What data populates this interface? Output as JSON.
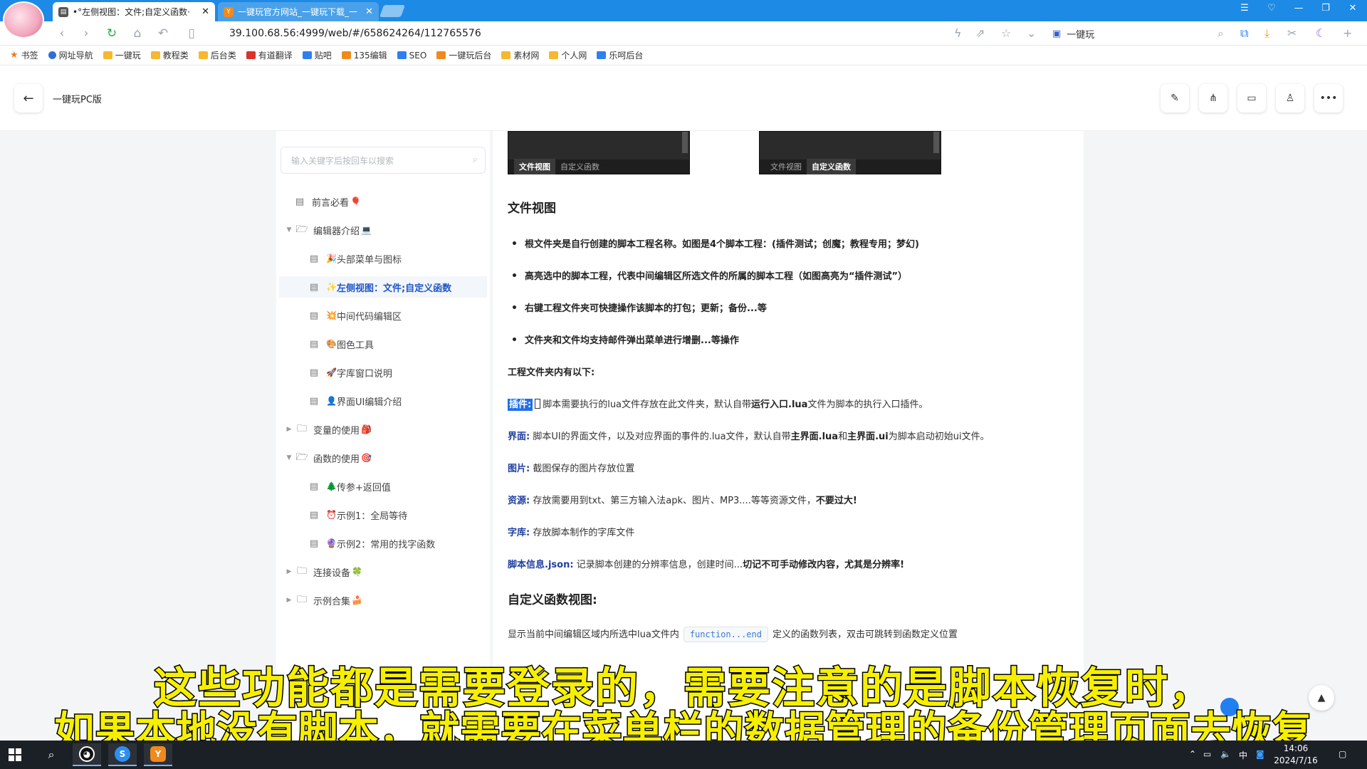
{
  "browser": {
    "tabs": [
      {
        "title": "•°左侧视图：文件;自定义函数·",
        "active": true
      },
      {
        "title": "一键玩官方网站_一键玩下载_一",
        "active": false
      }
    ],
    "url": "39.100.68.56:4999/web/#/658624264/112765576",
    "search_text": "一键玩",
    "bookmarks": [
      {
        "label": "书签",
        "icon": "star-icon"
      },
      {
        "label": "网址导航",
        "icon": "nav-icon"
      },
      {
        "label": "一键玩",
        "icon": "folder-icon"
      },
      {
        "label": "教程类",
        "icon": "folder-icon"
      },
      {
        "label": "后台类",
        "icon": "folder-icon"
      },
      {
        "label": "有道翻译",
        "icon": "youdao-icon"
      },
      {
        "label": "贴吧",
        "icon": "paw-icon"
      },
      {
        "label": "135编辑",
        "icon": "editor-icon"
      },
      {
        "label": "SEO",
        "icon": "paw-icon"
      },
      {
        "label": "一键玩后台",
        "icon": "app-icon"
      },
      {
        "label": "素材网",
        "icon": "folder-icon"
      },
      {
        "label": "个人网",
        "icon": "folder-icon"
      },
      {
        "label": "乐呵后台",
        "icon": "app-icon"
      }
    ]
  },
  "header": {
    "title": "一键玩PC版",
    "back_icon": "←"
  },
  "sidebar": {
    "search_placeholder": "输入关键字后按回车以搜索",
    "items": [
      {
        "label": "前言必看",
        "emoji": "🎈",
        "kind": "doc",
        "level": 0
      },
      {
        "label": "编辑器介绍",
        "emoji": "💻",
        "kind": "folder-open",
        "level": 0
      },
      {
        "label": "头部菜单与图标",
        "emoji": "🎉",
        "kind": "doc",
        "level": 1
      },
      {
        "label": "左侧视图：文件;自定义函数",
        "emoji": "✨",
        "kind": "doc",
        "level": 1,
        "active": true
      },
      {
        "label": "中间代码编辑区",
        "emoji": "💥",
        "kind": "doc",
        "level": 1
      },
      {
        "label": "图色工具",
        "emoji": "🎨",
        "kind": "doc",
        "level": 1
      },
      {
        "label": "字库窗口说明",
        "emoji": "🚀",
        "kind": "doc",
        "level": 1
      },
      {
        "label": "界面UI编辑介绍",
        "emoji": "👤",
        "kind": "doc",
        "level": 1
      },
      {
        "label": "变量的使用",
        "emoji": "🎒",
        "kind": "folder",
        "level": 0
      },
      {
        "label": "函数的使用",
        "emoji": "🎯",
        "kind": "folder-open",
        "level": 0
      },
      {
        "label": "传参+返回值",
        "emoji": "🌲",
        "kind": "doc",
        "level": 1
      },
      {
        "label": "示例1：全局等待",
        "emoji": "⏰",
        "kind": "doc",
        "level": 1
      },
      {
        "label": "示例2：常用的找字函数",
        "emoji": "🔮",
        "kind": "doc",
        "level": 1
      },
      {
        "label": "连接设备",
        "emoji": "🍀",
        "kind": "folder",
        "level": 0
      },
      {
        "label": "示例合集",
        "emoji": "🍰",
        "kind": "folder",
        "level": 0
      }
    ]
  },
  "content": {
    "thumb_left": {
      "tab1": "文件视图",
      "tab2": "自定义函数"
    },
    "thumb_right": {
      "tab1": "文件视图",
      "tab2": "自定义函数"
    },
    "section1_title": "文件视图",
    "bullets": [
      "根文件夹是自行创建的脚本工程名称。如图是4个脚本工程：(插件测试；创魔；教程专用；梦幻)",
      "高亮选中的脚本工程，代表中间编辑区所选文件的所属的脚本工程（如图高亮为“插件测试”）",
      "右键工程文件夹可快捷操作该脚本的打包；更新；备份...等",
      "文件夹和文件均支持邮件弹出菜单进行增删...等操作"
    ],
    "subheading": "工程文件夹内有以下:",
    "plugin": {
      "key": "插件:",
      "t1": "脚本需要执行的lua文件存放在此文件夹，默认自带",
      "b1": "运行入口.lua",
      "t2": "文件为脚本的执行入口插件。"
    },
    "ui": {
      "key": "界面:",
      "t1": "脚本UI的界面文件，以及对应界面的事件的.lua文件，默认自带",
      "b1": "主界面.lua",
      "t2": "和",
      "b2": "主界面.ui",
      "t3": "为脚本启动初始ui文件。"
    },
    "image": {
      "key": "图片:",
      "t1": "截图保存的图片存放位置"
    },
    "resource": {
      "key": "资源:",
      "t1": "存放需要用到txt、第三方输入法apk、图片、MP3....等等资源文件，",
      "b1": "不要过大!"
    },
    "fontlib": {
      "key": "字库:",
      "t1": "存放脚本制作的字库文件"
    },
    "scriptinfo": {
      "key": "脚本信息.json:",
      "t1": "记录脚本创建的分辨率信息，创建时间...",
      "b1": "切记不可手动修改内容，尤其是分辨率!"
    },
    "section2_title": "自定义函数视图:",
    "func_desc": {
      "t1": "显示当前中间编辑区域内所选中lua文件内",
      "code": "function...end",
      "t2": "定义的函数列表，双击可跳转到函数定义位置"
    }
  },
  "subtitles": {
    "line1": "这些功能都是需要登录的，需要注意的是脚本恢复时，",
    "line2": "如果本地没有脚本，就需要在菜单栏的数据管理的备份管理页面去恢复"
  },
  "taskbar": {
    "time": "14:06",
    "date": "2024/7/16",
    "ime": "中"
  }
}
